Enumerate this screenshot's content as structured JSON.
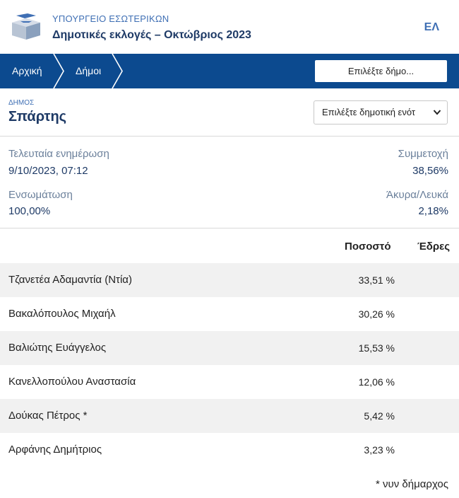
{
  "header": {
    "ministry": "ΥΠΟΥΡΓΕΙΟ ΕΣΩΤΕΡΙΚΩΝ",
    "title": "Δημοτικές εκλογές – Οκτώβριος 2023",
    "language": "ΕΛ"
  },
  "breadcrumb": {
    "home": "Αρχική",
    "municipalities": "Δήμοι"
  },
  "municipality_select": {
    "label": "Επιλέξτε δήμο..."
  },
  "municipality": {
    "label": "ΔΗΜΟΣ",
    "name": "Σπάρτης",
    "unit_select_label": "Επιλέξτε δημοτική ενότ"
  },
  "stats": {
    "last_update_label": "Τελευταία ενημέρωση",
    "last_update_value": "9/10/2023, 07:12",
    "turnout_label": "Συμμετοχή",
    "turnout_value": "38,56%",
    "integration_label": "Ενσωμάτωση",
    "integration_value": "100,00%",
    "invalid_label": "Άκυρα/Λευκά",
    "invalid_value": "2,18%"
  },
  "results": {
    "columns": {
      "percent": "Ποσοστό",
      "seats": "Έδρες"
    },
    "rows": [
      {
        "name": "Τζανετέα Αδαμαντία (Ντία)",
        "percent": "33,51 %"
      },
      {
        "name": "Βακαλόπουλος Μιχαήλ",
        "percent": "30,26 %"
      },
      {
        "name": "Βαλιώτης Ευάγγελος",
        "percent": "15,53 %"
      },
      {
        "name": "Κανελλοπούλου Αναστασία",
        "percent": "12,06 %"
      },
      {
        "name": "Δούκας Πέτρος *",
        "percent": "5,42 %"
      },
      {
        "name": "Αρφάνης Δημήτριος",
        "percent": "3,23 %"
      }
    ],
    "footnote": "* νυν δήμαρχος"
  },
  "colors": {
    "navbar": "#0c4a8f",
    "title": "#1e3a66",
    "accent": "#3f6fb4",
    "row_shade": "#f1f1f1"
  }
}
